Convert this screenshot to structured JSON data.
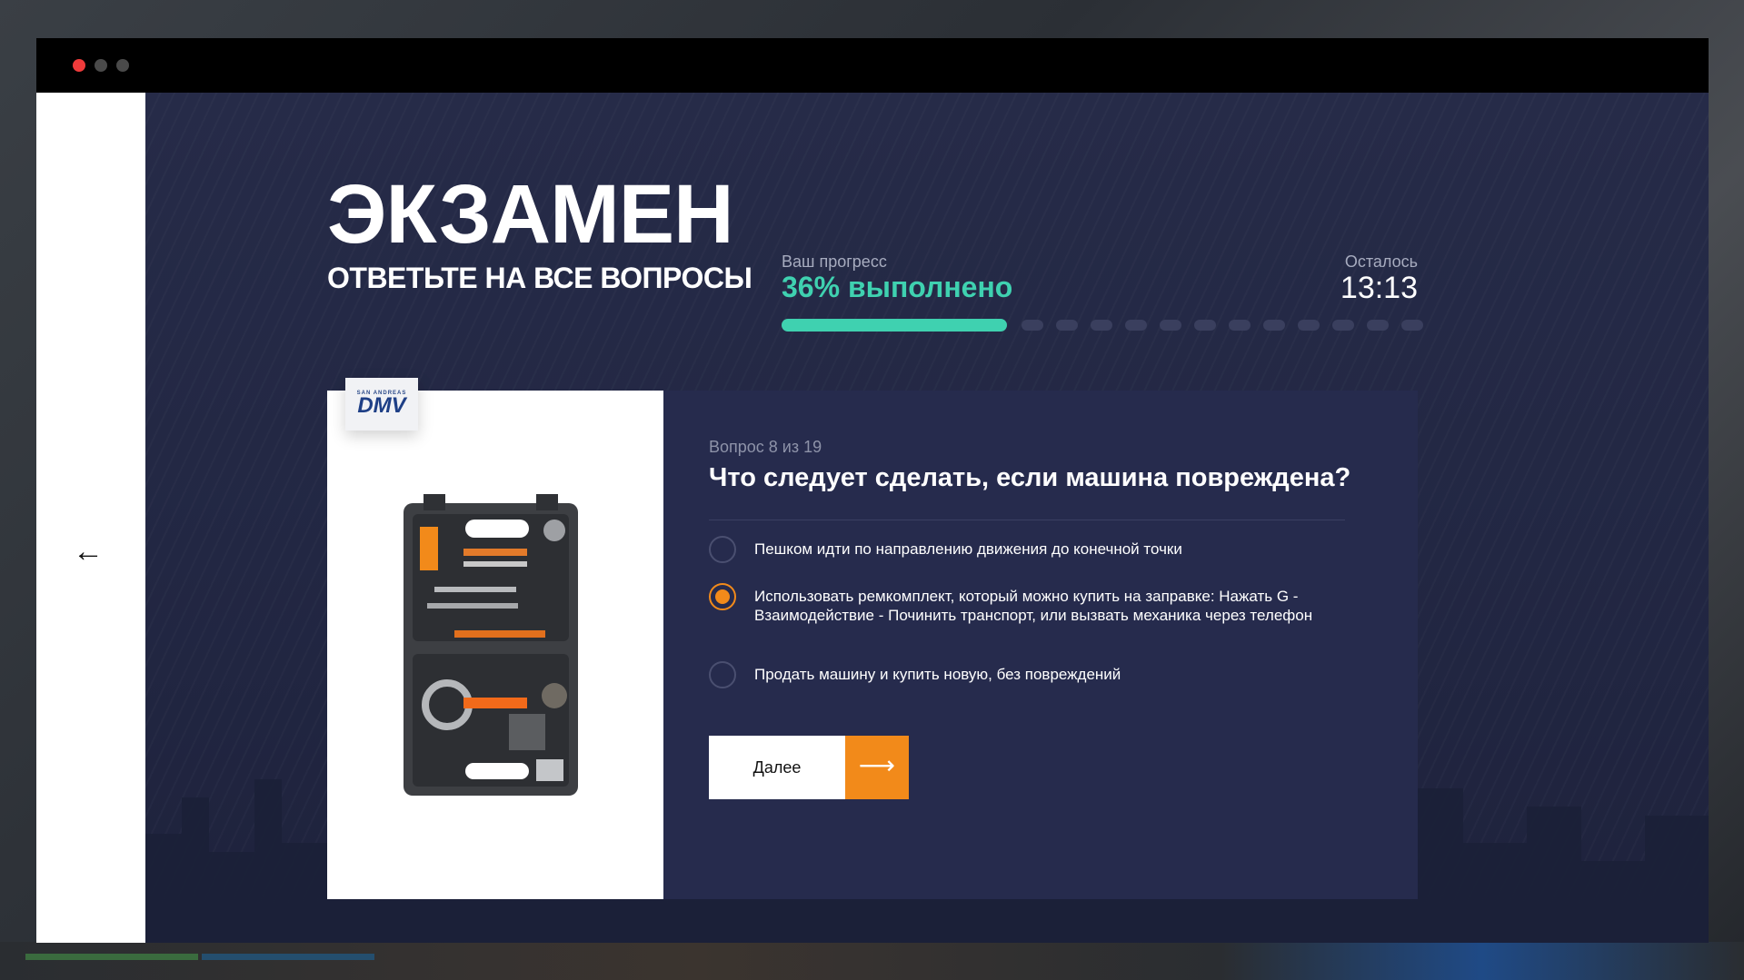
{
  "header": {
    "title": "ЭКЗАМЕН",
    "subtitle": "ОТВЕТЬТЕ НА ВСЕ ВОПРОСЫ"
  },
  "progress": {
    "label": "Ваш прогресс",
    "value_text": "36% выполнено",
    "fraction": 0.36,
    "remaining_steps": 12
  },
  "timer": {
    "label": "Осталось",
    "value": "13:13"
  },
  "question": {
    "counter": "Вопрос 8 из 19",
    "text": "Что следует сделать, если машина повреждена?",
    "image_badge": {
      "small_text": "SAN ANDREAS",
      "text": "DMV"
    },
    "image_subject": "toolkit-case"
  },
  "answers": [
    {
      "text": "Пешком идти по направлению движения до конечной точки",
      "selected": false
    },
    {
      "text": "Использовать ремкомплект, который можно купить на заправке: Нажать G - Взаимодействие - Починить транспорт, или вызвать механика через телефон",
      "selected": true
    },
    {
      "text": "Продать машину и купить новую, без повреждений",
      "selected": false
    }
  ],
  "next_button": {
    "label": "Далее",
    "icon": "arrow-right-icon"
  },
  "nav": {
    "back_icon": "arrow-left-icon",
    "back_glyph": "←"
  },
  "colors": {
    "accent": "#f28a1a",
    "progress": "#3fd1b0",
    "panel": "#262b4d",
    "background": "#222743"
  }
}
